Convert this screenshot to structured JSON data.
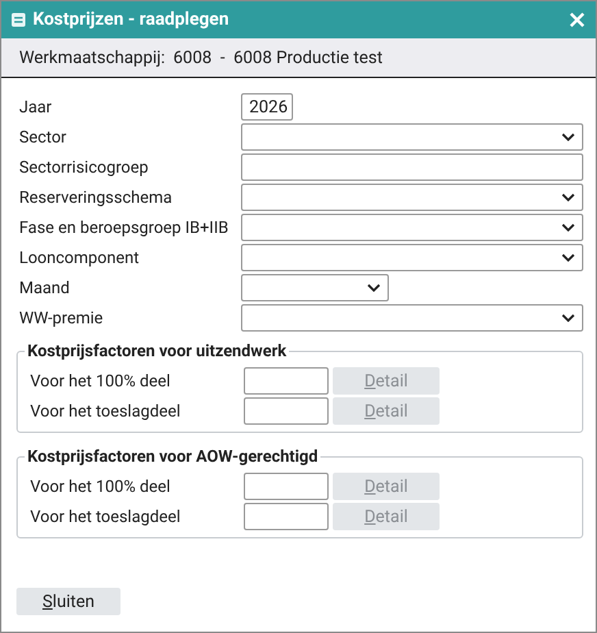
{
  "window": {
    "title": "Kostprijzen - raadplegen"
  },
  "header": {
    "label": "Werkmaatschappij:",
    "value": "6008  -  6008 Productie test"
  },
  "fields": [
    {
      "label": "Jaar",
      "kind": "short-input",
      "value": "2026"
    },
    {
      "label": "Sector",
      "kind": "select"
    },
    {
      "label": "Sectorrisicogroep",
      "kind": "input"
    },
    {
      "label": "Reserveringsschema",
      "kind": "select"
    },
    {
      "label": "Fase en beroepsgroep IB+IIB",
      "kind": "select"
    },
    {
      "label": "Looncomponent",
      "kind": "select"
    },
    {
      "label": "Maand",
      "kind": "short-select"
    },
    {
      "label": "WW-premie",
      "kind": "select"
    }
  ],
  "groups": [
    {
      "title": "Kostprijsfactoren voor uitzendwerk",
      "rows": [
        {
          "label": "Voor het 100% deel",
          "button": {
            "label": "Detail",
            "underline_first": true,
            "disabled": true
          }
        },
        {
          "label": "Voor het toeslagdeel",
          "button": {
            "label": "Detail",
            "underline_first": true,
            "disabled": true
          }
        }
      ]
    },
    {
      "title": "Kostprijsfactoren voor AOW-gerechtigd",
      "rows": [
        {
          "label": "Voor het 100% deel",
          "button": {
            "label": "Detail",
            "underline_first": true,
            "disabled": true
          }
        },
        {
          "label": "Voor het toeslagdeel",
          "button": {
            "label": "Detail",
            "underline_first": true,
            "disabled": true
          }
        }
      ]
    }
  ],
  "buttons": [
    {
      "label": "Sluiten",
      "underline_first": true,
      "disabled": false
    }
  ]
}
